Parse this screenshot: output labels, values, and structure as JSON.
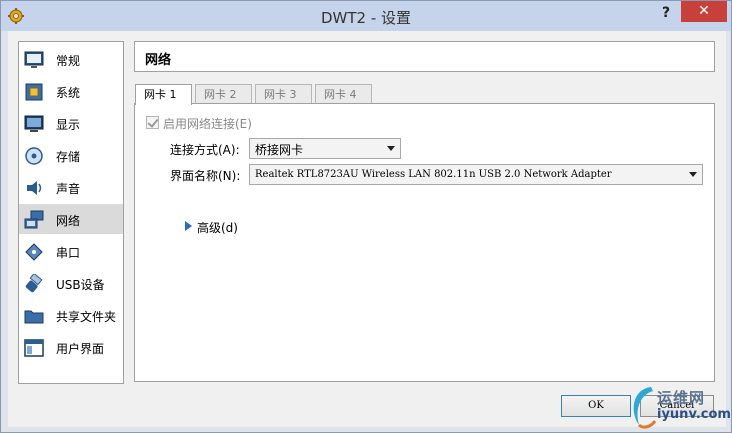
{
  "window": {
    "title": "DWT2 - 设置",
    "help": "?",
    "close": "✕"
  },
  "sidebar": {
    "items": [
      {
        "label": "常规",
        "icon": "monitor-icon"
      },
      {
        "label": "系统",
        "icon": "chip-icon"
      },
      {
        "label": "显示",
        "icon": "display-icon"
      },
      {
        "label": "存储",
        "icon": "disc-icon"
      },
      {
        "label": "声音",
        "icon": "speaker-icon"
      },
      {
        "label": "网络",
        "icon": "network-icon",
        "selected": true
      },
      {
        "label": "串口",
        "icon": "serial-port-icon"
      },
      {
        "label": "USB设备",
        "icon": "usb-icon"
      },
      {
        "label": "共享文件夹",
        "icon": "folder-icon"
      },
      {
        "label": "用户界面",
        "icon": "window-icon"
      }
    ]
  },
  "main": {
    "section_title": "网络",
    "tabs": [
      {
        "label": "网卡 1",
        "active": true
      },
      {
        "label": "网卡 2"
      },
      {
        "label": "网卡 3"
      },
      {
        "label": "网卡 4"
      }
    ],
    "enable_label": "启用网络连接(E)",
    "enable_checked": true,
    "attach_label": "连接方式(A):",
    "attach_value": "桥接网卡",
    "name_label": "界面名称(N):",
    "name_value": "Realtek RTL8723AU Wireless LAN 802.11n USB 2.0 Network Adapter",
    "advanced_label": "高级(d)"
  },
  "buttons": {
    "ok": "OK",
    "cancel": "Cancel"
  },
  "watermark": {
    "line1": "运维网",
    "line2": "iyunv.com"
  },
  "colors": {
    "titlebar": "#c5d4ea",
    "close": "#c7413a",
    "selected_item": "#dadada",
    "accent_arrow": "#2a6fb3"
  }
}
